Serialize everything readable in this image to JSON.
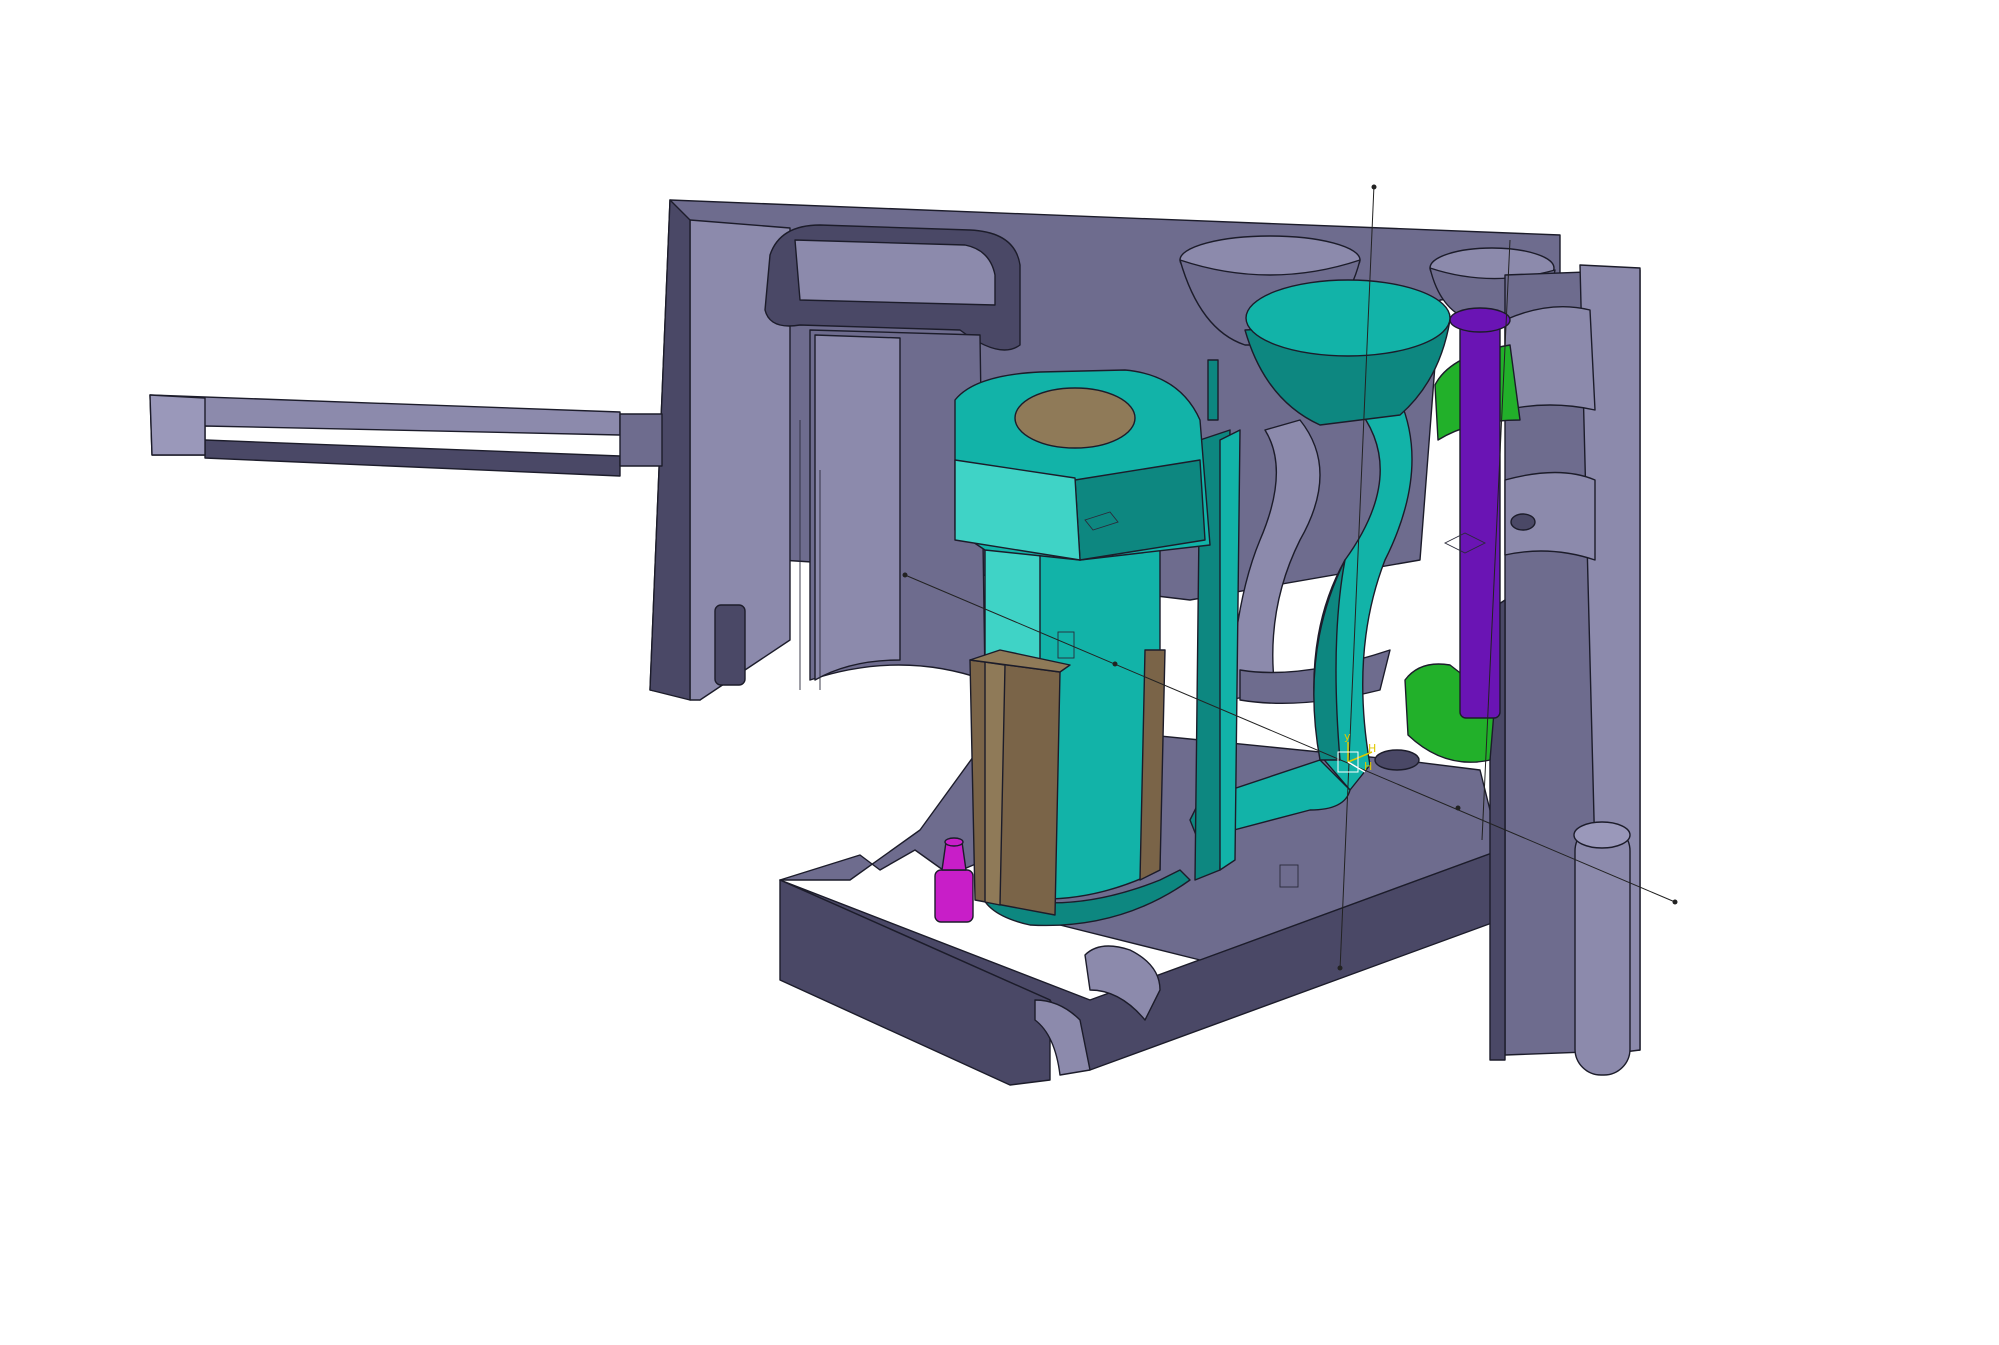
{
  "scene": {
    "background": "#ffffff",
    "colors": {
      "mold_steel_light": "#8c8aac",
      "mold_steel_mid": "#6e6c8e",
      "mold_steel_dark": "#4a4866",
      "mold_steel_top": "#9a98ba",
      "cast_part_teal": "#12b3a8",
      "cast_part_teal_dark": "#0d8780",
      "cast_part_teal_light": "#3fd3c6",
      "core_brown": "#7a6448",
      "core_tan": "#8f7a58",
      "slide_green": "#22b02a",
      "pin_purple": "#6a14b4",
      "locator_magenta": "#c81ec8",
      "axis_triad": "#e0c800",
      "edge": "#1c1c2a"
    },
    "axis_triad": {
      "labels": [
        "y",
        "H",
        "H"
      ]
    }
  }
}
